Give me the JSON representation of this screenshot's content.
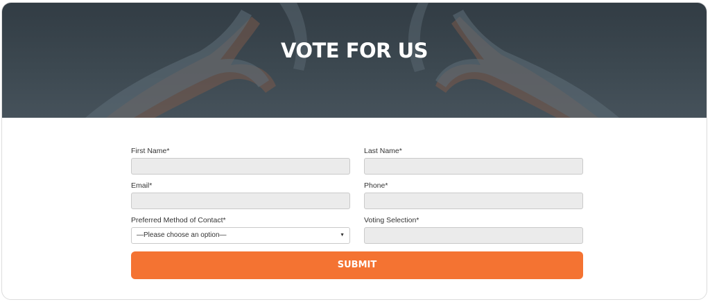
{
  "hero": {
    "title": "VOTE FOR US"
  },
  "form": {
    "first_name": {
      "label": "First Name*",
      "value": ""
    },
    "last_name": {
      "label": "Last Name*",
      "value": ""
    },
    "email": {
      "label": "Email*",
      "value": ""
    },
    "phone": {
      "label": "Phone*",
      "value": ""
    },
    "contact_method": {
      "label": "Preferred Method of Contact*",
      "selected": "—Please choose an option—",
      "caret_icon": "caret-down-icon"
    },
    "voting_selection": {
      "label": "Voting Selection*",
      "value": ""
    },
    "submit_label": "SUBMIT"
  },
  "colors": {
    "hero_bg": "#3c4850",
    "accent": "#f47332",
    "input_bg": "#ebebeb",
    "input_border": "#c9c9c9"
  }
}
